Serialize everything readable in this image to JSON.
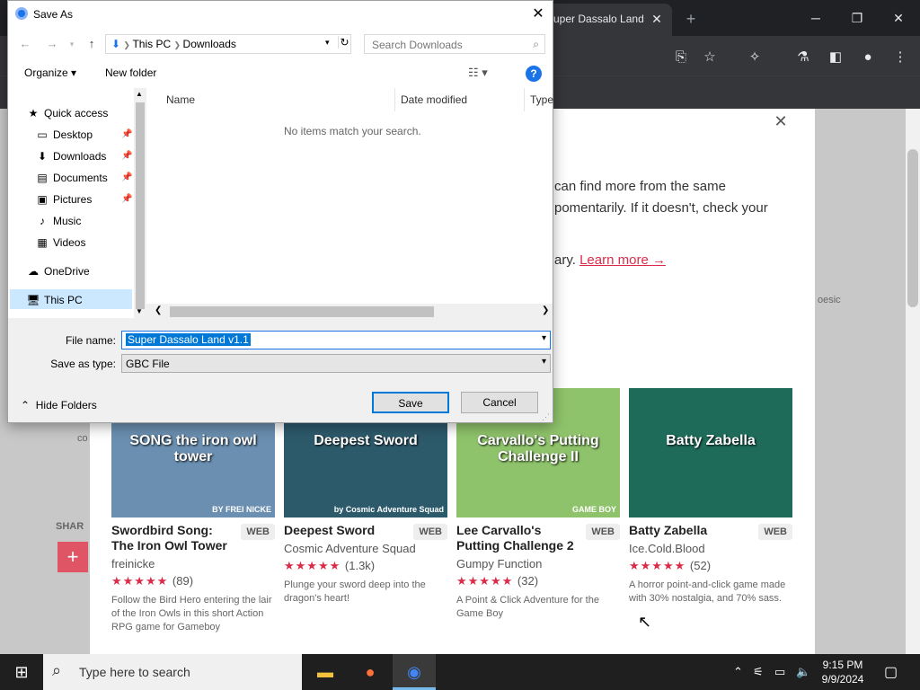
{
  "browser": {
    "tab_title": "Super Dassalo Land",
    "tab_close": "✕",
    "new_tab": "+"
  },
  "page": {
    "modal_line1": "can find more from the same",
    "modal_line2": "pomentarily. If it doesn't, check your",
    "modal_line3_prefix": "ary.",
    "learn_more": "Learn more →",
    "side_text": "oesic",
    "share_label": "SHAR",
    "co_text": "co",
    "games": [
      {
        "title": "Swordbird Song: The Iron Owl Tower",
        "badge": "WEB",
        "author": "freinicke",
        "stars": "★★★★★",
        "count": "(89)",
        "desc": "Follow the Bird Hero entering the lair of the Iron Owls in this short Action RPG game for Gameboy",
        "thumb_text": "SONG the iron owl tower",
        "thumb_badge": "BY FREI NICKE",
        "color": "#6b8fb0"
      },
      {
        "title": "Deepest Sword",
        "badge": "WEB",
        "author": "Cosmic Adventure Squad",
        "stars": "★★★★★",
        "count": "(1.3k)",
        "desc": "Plunge your sword deep into the dragon's heart!",
        "thumb_text": "Deepest Sword",
        "thumb_badge": "by Cosmic Adventure Squad",
        "color": "#2d5a6b"
      },
      {
        "title": "Lee Carvallo's Putting Challenge 2",
        "badge": "WEB",
        "author": "Gumpy Function",
        "stars": "★★★★★",
        "count": "(32)",
        "desc": "A Point & Click Adventure for the Game Boy",
        "thumb_text": "Carvallo's Putting Challenge II",
        "thumb_badge": "GAME BOY",
        "color": "#8fc36b"
      },
      {
        "title": "Batty Zabella",
        "badge": "WEB",
        "author": "Ice.Cold.Blood",
        "stars": "★★★★★",
        "count": "(52)",
        "desc": "A horror point-and-click game made with 30% nostalgia, and 70% sass.",
        "thumb_text": "Batty Zabella",
        "thumb_badge": "",
        "color": "#1e6b5a"
      }
    ]
  },
  "dialog": {
    "title": "Save As",
    "close": "✕",
    "breadcrumb": [
      "This PC",
      "Downloads"
    ],
    "search_placeholder": "Search Downloads",
    "organize": "Organize ▾",
    "new_folder": "New folder",
    "help": "?",
    "nav": [
      {
        "label": "Quick access",
        "icon": "★",
        "pinned": false
      },
      {
        "label": "Desktop",
        "icon": "▭",
        "pinned": true
      },
      {
        "label": "Downloads",
        "icon": "⬇",
        "pinned": true
      },
      {
        "label": "Documents",
        "icon": "▤",
        "pinned": true
      },
      {
        "label": "Pictures",
        "icon": "▣",
        "pinned": true
      },
      {
        "label": "Music",
        "icon": "♪",
        "pinned": false
      },
      {
        "label": "Videos",
        "icon": "▦",
        "pinned": false
      },
      {
        "label": "OneDrive",
        "icon": "☁",
        "pinned": false
      },
      {
        "label": "This PC",
        "icon": "🖥",
        "pinned": false
      }
    ],
    "columns": [
      "Name",
      "Date modified",
      "Type"
    ],
    "empty_message": "No items match your search.",
    "file_name_label": "File name:",
    "file_name_value": "Super Dassalo Land v1.1",
    "save_as_type_label": "Save as type:",
    "save_as_type_value": "GBC File",
    "hide_folders": "Hide Folders",
    "save": "Save",
    "cancel": "Cancel"
  },
  "taskbar": {
    "search_placeholder": "Type here to search",
    "time": "9:15 PM",
    "date": "9/9/2024"
  }
}
